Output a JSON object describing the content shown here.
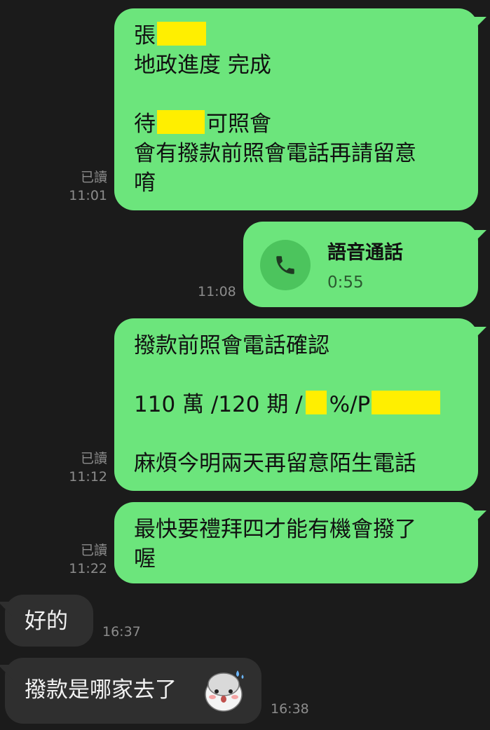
{
  "messages": {
    "m1": {
      "line1": "張",
      "line2": "地政進度 完成",
      "line4a": "待",
      "line4b": "可照會",
      "line5": "會有撥款前照會電話再請留意",
      "line6": "唷",
      "read": "已讀",
      "time": "11:01"
    },
    "m2": {
      "title": "語音通話",
      "duration": "0:55",
      "icon": "phone-icon",
      "time": "11:08"
    },
    "m3": {
      "line1": "撥款前照會電話確認",
      "line3a": "110 萬 /120 期 /",
      "line3b": "%/P",
      "line5": "麻煩今明兩天再留意陌生電話",
      "read": "已讀",
      "time": "11:12"
    },
    "m4": {
      "line1": "最快要禮拜四才能有機會撥了",
      "line2": "喔",
      "read": "已讀",
      "time": "11:22"
    },
    "m5": {
      "text": "好的",
      "time": "16:37"
    },
    "m6": {
      "text": "撥款是哪家去了",
      "sticker": "sweating-hamster-sticker",
      "time": "16:38"
    }
  },
  "colors": {
    "background": "#1b1b1b",
    "outgoing_bubble": "#6ce57c",
    "incoming_bubble": "#2f2f2f",
    "redaction": "#ffef00",
    "meta_text": "#8c8c8c"
  }
}
